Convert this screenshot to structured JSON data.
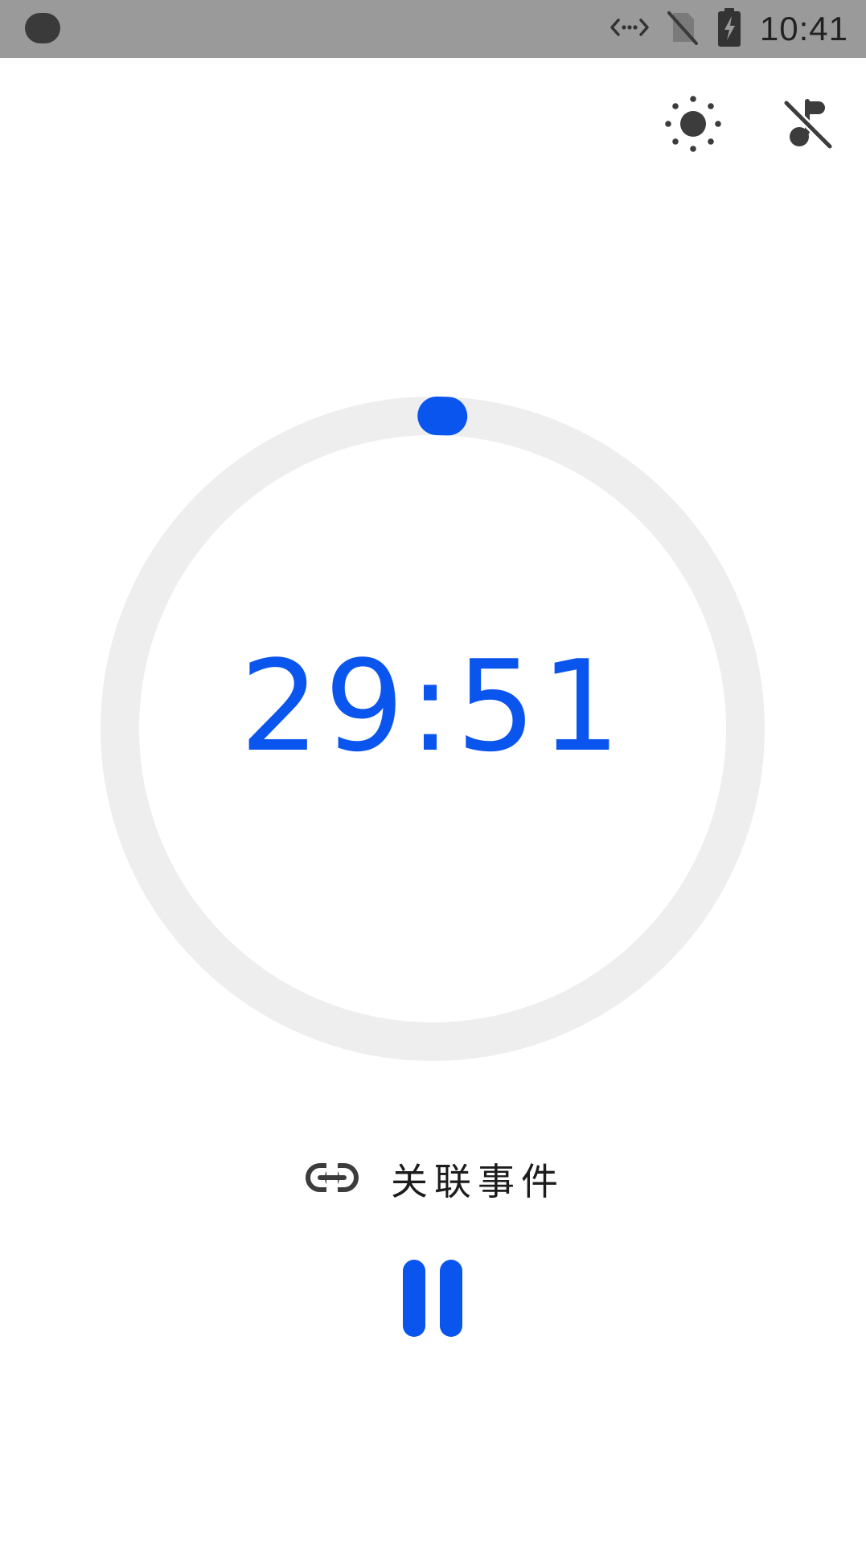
{
  "status_bar": {
    "time": "10:41",
    "icons": [
      "indicator-pill",
      "data-transfer-icon",
      "no-sim-icon",
      "battery-charging-icon"
    ]
  },
  "toolbar": {
    "brightness_icon": "sun-icon",
    "sound_icon": "music-off-icon"
  },
  "timer": {
    "display": "29:51",
    "progress_fraction": 0.005
  },
  "link_event": {
    "icon": "link-icon",
    "label": "关联事件"
  },
  "controls": {
    "pause_icon": "pause-icon"
  },
  "colors": {
    "accent": "#0a55ee",
    "ring_track": "#eeeeee",
    "status_bar_bg": "#9a9a9a",
    "icon_gray": "#3c3c3c"
  }
}
